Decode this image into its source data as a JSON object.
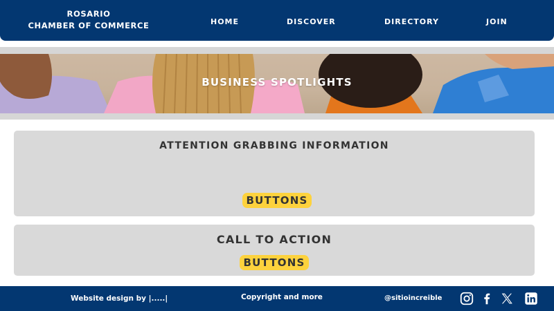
{
  "header": {
    "brand_line1": "ROSARIO",
    "brand_line2": "CHAMBER OF COMMERCE",
    "nav": [
      {
        "label": "HOME"
      },
      {
        "label": "DISCOVER"
      },
      {
        "label": "DIRECTORY"
      },
      {
        "label": "JOIN"
      }
    ]
  },
  "hero": {
    "title": "BUSINESS SPOTLIGHTS"
  },
  "cards": [
    {
      "title": "ATTENTION GRABBING INFORMATION",
      "button": "BUTTONS"
    },
    {
      "title": "CALL TO ACTION",
      "button": "BUTTONS"
    }
  ],
  "footer": {
    "credit": "Website design by |.....|",
    "copyright": "Copyright and more",
    "handle": "@sitioincreible",
    "social_icons": [
      "instagram-icon",
      "facebook-icon",
      "x-icon",
      "linkedin-icon"
    ]
  },
  "colors": {
    "primary": "#033771",
    "accent": "#fdd23d",
    "card": "#d9d9d9"
  }
}
